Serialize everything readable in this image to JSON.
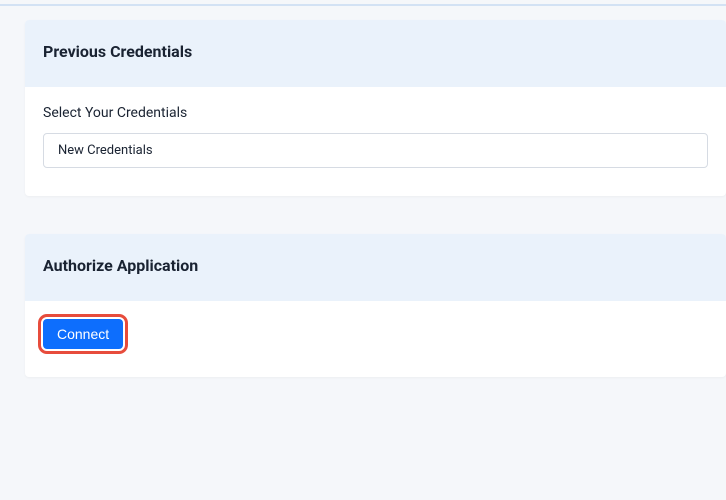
{
  "sections": {
    "previous_credentials": {
      "title": "Previous Credentials",
      "field_label": "Select Your Credentials",
      "selected_value": "New Credentials"
    },
    "authorize_application": {
      "title": "Authorize Application",
      "connect_label": "Connect"
    }
  }
}
